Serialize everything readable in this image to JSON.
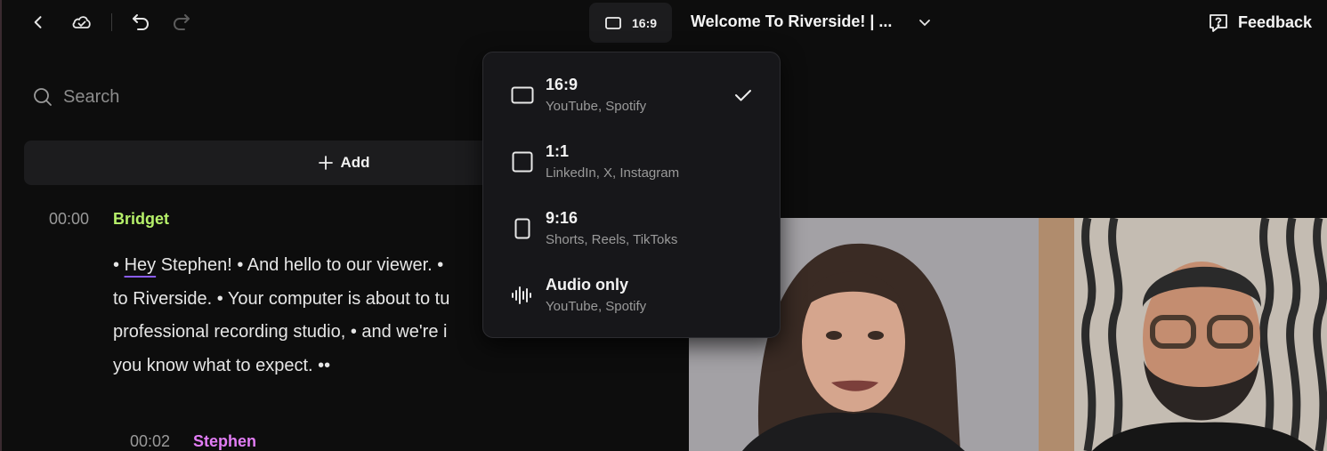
{
  "toolbar": {
    "aspect_ratio_label": "16:9",
    "project_title": "Welcome To Riverside! | ...",
    "feedback_label": "Feedback"
  },
  "sidebar": {
    "search_placeholder": "Search",
    "add_label": "Add"
  },
  "transcript": [
    {
      "timestamp": "00:00",
      "speaker": "Bridget",
      "speaker_color": "#b6f06a",
      "lines": [
        [
          "• ",
          "Hey",
          " Stephen! • And hello to our viewer. •"
        ],
        [
          "to Riverside. • Your computer is about to tu"
        ],
        [
          "professional recording studio, • and we're i"
        ],
        [
          "you know what to expect. ••"
        ]
      ]
    },
    {
      "timestamp": "00:02",
      "speaker": "Stephen",
      "speaker_color": "#e27df5"
    }
  ],
  "aspect_menu": {
    "items": [
      {
        "title": "16:9",
        "subtitle": "YouTube, Spotify",
        "icon": "landscape-frame-icon",
        "selected": true
      },
      {
        "title": "1:1",
        "subtitle": "LinkedIn, X, Instagram",
        "icon": "square-frame-icon",
        "selected": false
      },
      {
        "title": "9:16",
        "subtitle": "Shorts, Reels, TikToks",
        "icon": "portrait-frame-icon",
        "selected": false
      },
      {
        "title": "Audio only",
        "subtitle": "YouTube, Spotify",
        "icon": "audio-waveform-icon",
        "selected": false
      }
    ]
  },
  "icons": {
    "back": "chevron-left-icon",
    "cloud": "cloud-check-icon",
    "undo": "undo-icon",
    "redo": "redo-icon",
    "project_dropdown": "chevron-down-icon",
    "feedback": "feedback-bubble-icon",
    "search": "search-icon",
    "add": "plus-icon",
    "check": "checkmark-icon"
  }
}
